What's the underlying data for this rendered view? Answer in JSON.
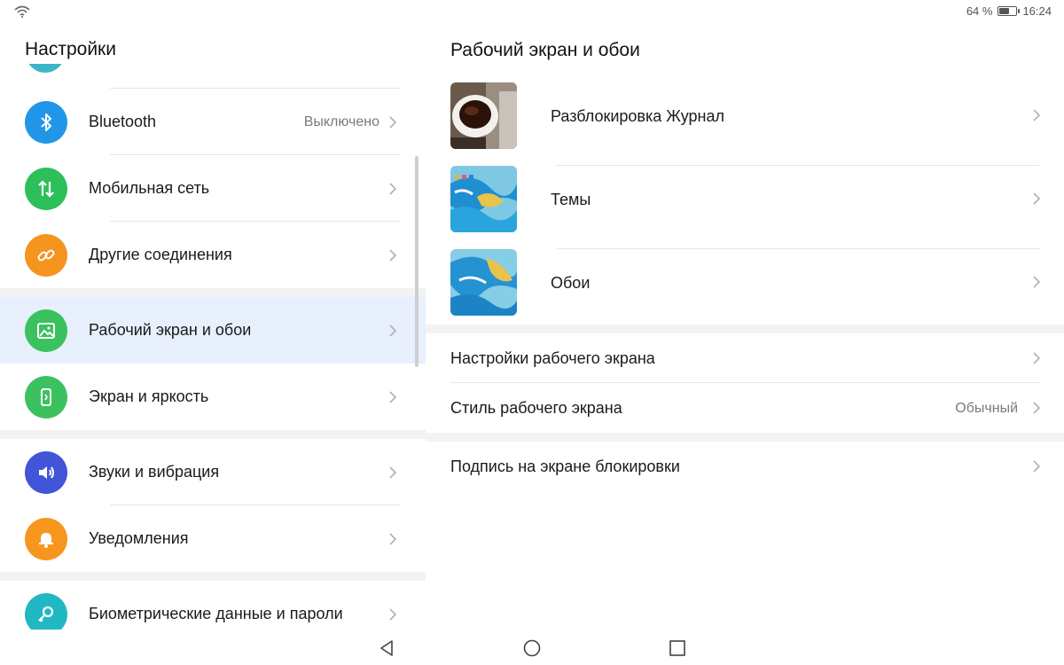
{
  "status_bar": {
    "battery_text": "64 %",
    "battery_level": 0.64,
    "time": "16:24"
  },
  "left_pane": {
    "title": "Настройки",
    "items": [
      {
        "label": "Bluetooth",
        "value": "Выключено",
        "icon": "bluetooth-icon",
        "color": "#2196e8"
      },
      {
        "label": "Мобильная сеть",
        "icon": "mobile-network-icon",
        "color": "#2dbf5a"
      },
      {
        "label": "Другие соединения",
        "icon": "link-icon",
        "color": "#f5941f"
      },
      {
        "label": "Рабочий экран и обои",
        "icon": "wallpaper-icon",
        "color": "#3cc15f",
        "selected": true
      },
      {
        "label": "Экран и яркость",
        "icon": "display-icon",
        "color": "#3cc15f"
      },
      {
        "label": "Звуки и вибрация",
        "icon": "volume-icon",
        "color": "#4254d8"
      },
      {
        "label": "Уведомления",
        "icon": "bell-icon",
        "color": "#f7961d"
      },
      {
        "label": "Биометрические данные и пароли",
        "icon": "key-icon",
        "color": "#21b8c4"
      }
    ]
  },
  "right_pane": {
    "title": "Рабочий экран и обои",
    "thumb_items": [
      {
        "label": "Разблокировка Журнал",
        "thumb": "coffee-cup-thumbnail"
      },
      {
        "label": "Темы",
        "thumb": "blue-marble-theme-thumbnail"
      },
      {
        "label": "Обои",
        "thumb": "blue-marble-wallpaper-thumbnail"
      }
    ],
    "settings": [
      {
        "label": "Настройки рабочего экрана"
      },
      {
        "label": "Стиль рабочего экрана",
        "value": "Обычный"
      }
    ],
    "extra": [
      {
        "label": "Подпись на экране блокировки"
      }
    ]
  }
}
